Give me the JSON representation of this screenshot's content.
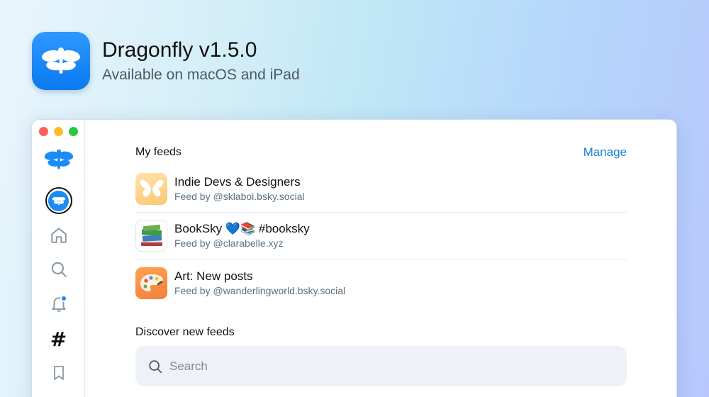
{
  "header": {
    "app_icon": "dragonfly-icon",
    "title": "Dragonfly v1.5.0",
    "subtitle": "Available on macOS and iPad"
  },
  "window": {
    "traffic_lights": [
      "close",
      "minimize",
      "zoom"
    ]
  },
  "sidebar": {
    "items": [
      {
        "name": "logo",
        "icon": "dragonfly-icon"
      },
      {
        "name": "profile",
        "icon": "avatar"
      },
      {
        "name": "home",
        "icon": "home-icon"
      },
      {
        "name": "search",
        "icon": "search-icon"
      },
      {
        "name": "notifications",
        "icon": "bell-icon",
        "has_badge": true
      },
      {
        "name": "feeds",
        "icon": "hash-icon",
        "glyph": "#"
      },
      {
        "name": "saved",
        "icon": "bookmark-icon"
      }
    ]
  },
  "main": {
    "my_feeds": {
      "title": "My feeds",
      "manage_label": "Manage",
      "items": [
        {
          "title": "Indie Devs & Designers",
          "author": "Feed by @sklaboi.bsky.social",
          "icon": "butterfly-icon"
        },
        {
          "title": "BookSky 💙📚 #booksky",
          "author": "Feed by @clarabelle.xyz",
          "icon": "books-icon"
        },
        {
          "title": "Art: New posts",
          "author": "Feed by @wanderlingworld.bsky.social",
          "icon": "palette-icon"
        }
      ]
    },
    "discover": {
      "title": "Discover new feeds",
      "search_placeholder": "Search"
    }
  },
  "colors": {
    "accent": "#1a82dd",
    "brand_blue": "#0a7af0",
    "close": "#ff5f57",
    "minimize": "#febc2e",
    "zoom": "#28c840"
  }
}
